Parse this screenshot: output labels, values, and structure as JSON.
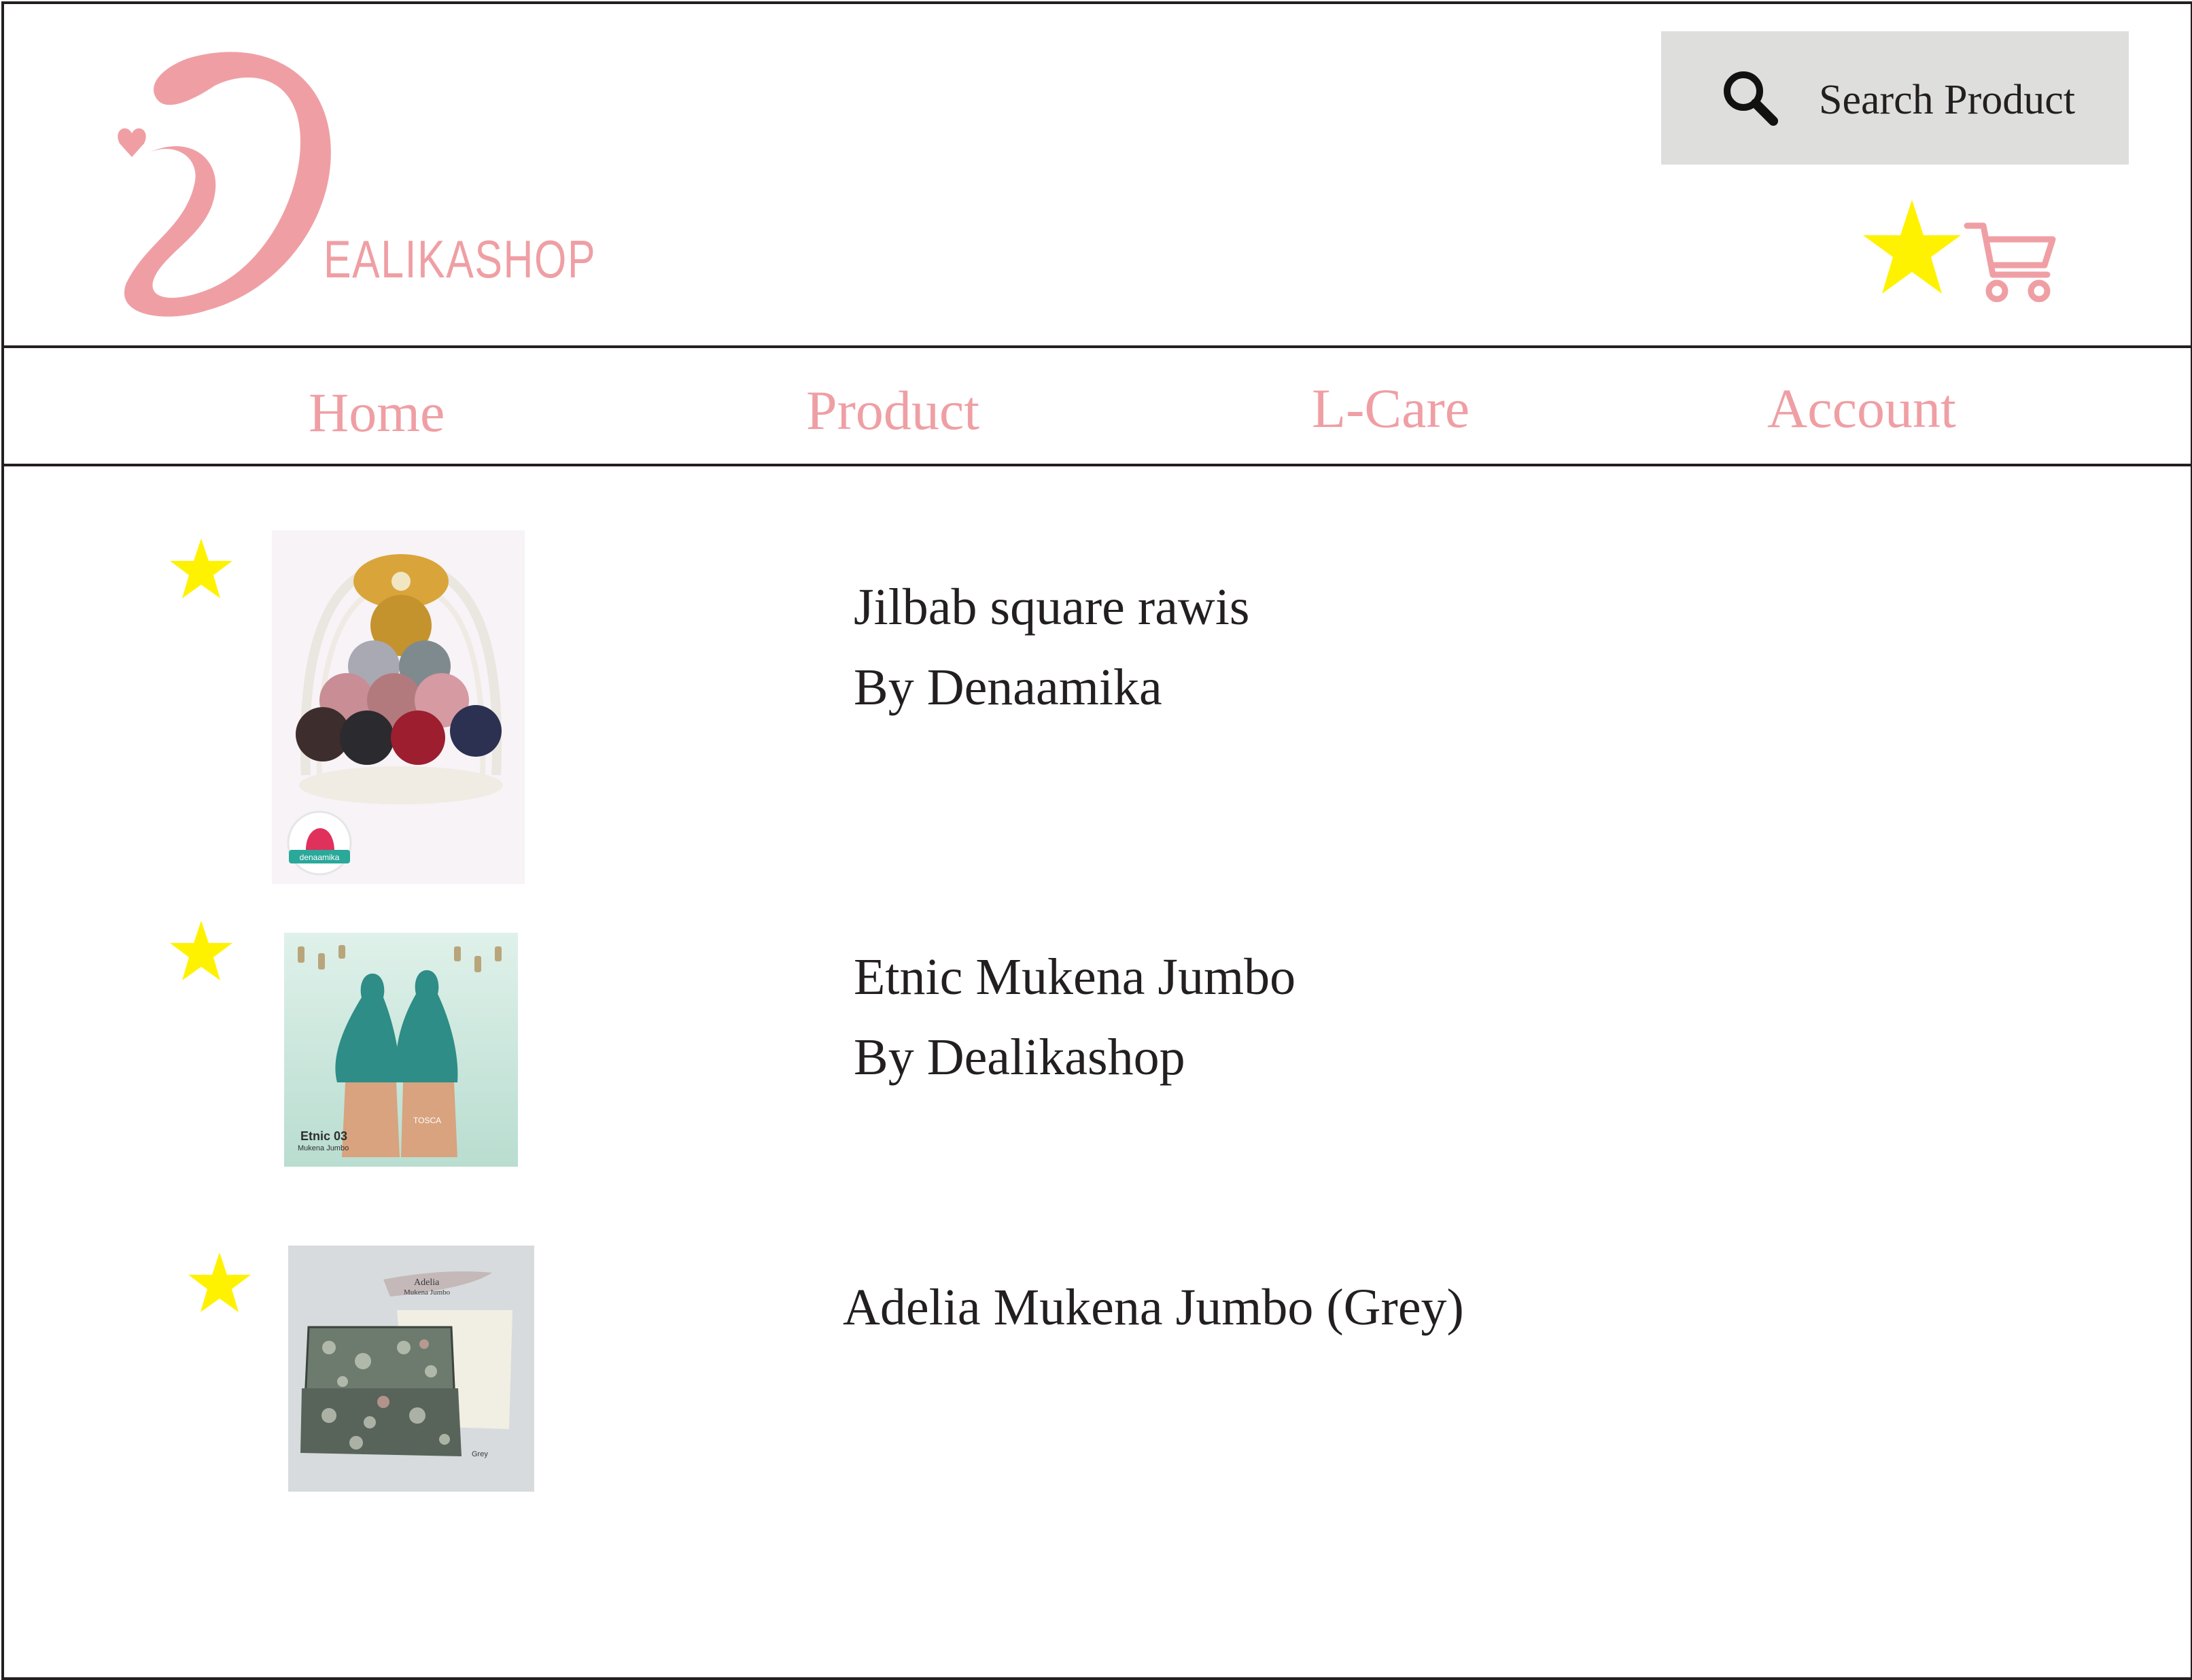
{
  "brand": {
    "name": "EALIKASHOP",
    "color": "#ef9fa4"
  },
  "search": {
    "label": "Search Product",
    "icon": "search-icon"
  },
  "header_icons": {
    "favorites": "star-icon",
    "favorites_color": "#fff200",
    "cart": "shopping-cart-icon",
    "cart_color": "#ef9fa4"
  },
  "nav": {
    "items": [
      {
        "label": "Home"
      },
      {
        "label": "Product"
      },
      {
        "label": "L-Care"
      },
      {
        "label": "Account"
      }
    ]
  },
  "favorites_list": {
    "items": [
      {
        "title": "Jilbab square rawis",
        "brand": "By Denaamika",
        "favorited": true,
        "thumb_label": "denaamika"
      },
      {
        "title": "Etnic Mukena Jumbo",
        "brand": "By Dealikashop",
        "favorited": true,
        "thumb_label": "Etnic 03",
        "thumb_sublabel": "Mukena Jumbo",
        "thumb_tag": "TOSCA"
      },
      {
        "title": "Adelia Mukena Jumbo (Grey)",
        "brand": "",
        "favorited": true,
        "thumb_label": "Adelia",
        "thumb_sublabel": "Mukena Jumbo",
        "thumb_tag": "Grey"
      }
    ]
  }
}
